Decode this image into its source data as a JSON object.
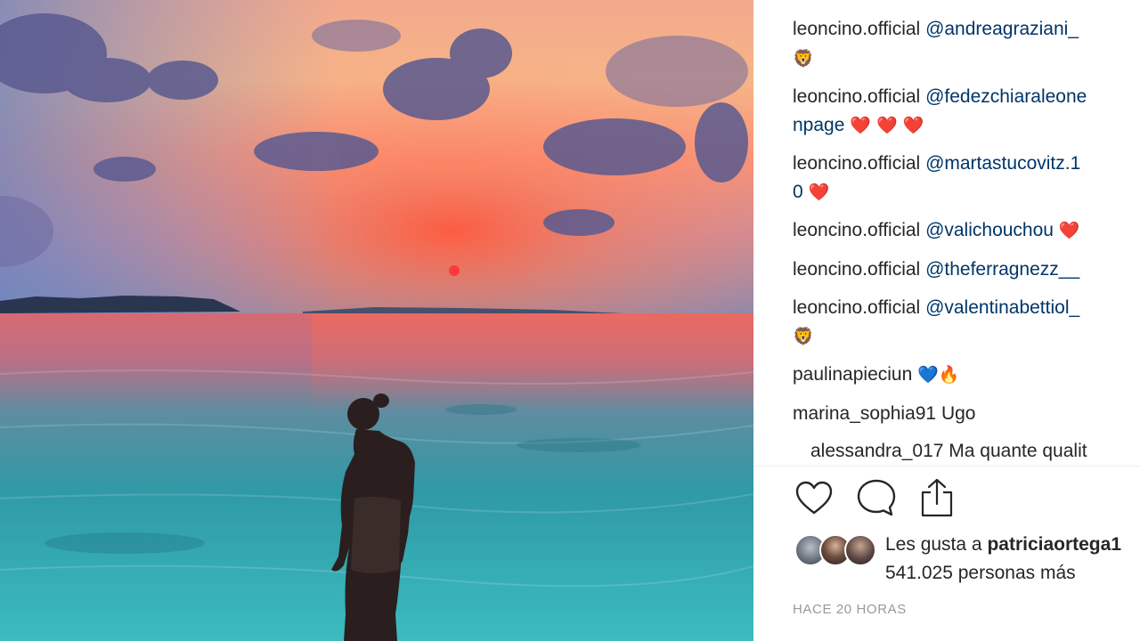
{
  "comments": [
    {
      "user": "leoncino.official",
      "mention": "@andreagraziani_",
      "cont": "",
      "emoji": "🦁"
    },
    {
      "user": "leoncino.official",
      "mention": "@fedezchiaraleone",
      "cont": "npage",
      "emoji": "❤️ ❤️ ❤️"
    },
    {
      "user": "leoncino.official",
      "mention": "@martastucovitz.1",
      "cont": "0",
      "emoji": "❤️"
    },
    {
      "user": "leoncino.official",
      "mention": "@valichouchou",
      "emoji": "❤️"
    },
    {
      "user": "leoncino.official",
      "mention": "@theferragnezz__"
    },
    {
      "user": "leoncino.official",
      "mention": "@valentinabettiol_",
      "emoji": "🦁"
    },
    {
      "user": "paulinapieciun",
      "emoji": "💙🔥"
    },
    {
      "user": "marina_sophia91",
      "text": "Ugo"
    },
    {
      "user": "alessandra_017",
      "text": "Ma quante qualit"
    }
  ],
  "actions": {
    "like_icon": "heart-icon",
    "comment_icon": "comment-icon",
    "share_icon": "share-icon"
  },
  "likes": {
    "prefix": "Les gusta a",
    "liker": "patriciaortega1",
    "suffix": "541.025 personas más"
  },
  "timestamp": "HACE 20 HORAS",
  "colors": {
    "mention": "#003569",
    "text": "#262626",
    "muted": "#999999"
  }
}
